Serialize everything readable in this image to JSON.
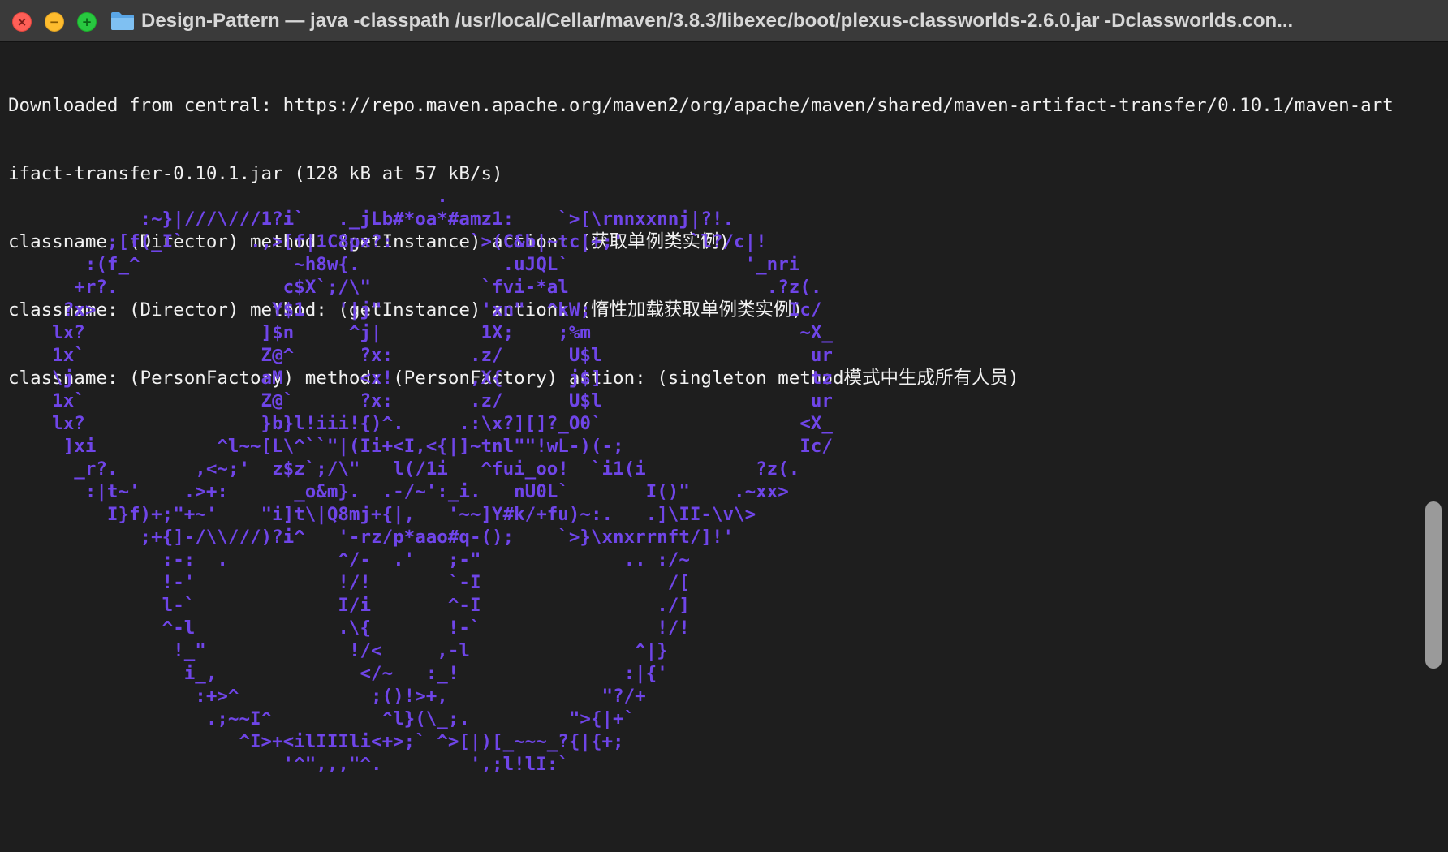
{
  "window": {
    "title": "Design-Pattern — java -classpath /usr/local/Cellar/maven/3.8.3/libexec/boot/plexus-classworlds-2.6.0.jar -Dclassworlds.con...",
    "buttons": {
      "close": "×",
      "minimize": "−",
      "maximize": "+"
    },
    "colors": {
      "close": "#fe5f57",
      "minimize": "#febc2e",
      "maximize": "#28c840",
      "background": "#1e1e1e",
      "art": "#6f45e8"
    }
  },
  "terminal": {
    "lines": [
      "Downloaded from central: https://repo.maven.apache.org/maven2/org/apache/maven/shared/maven-artifact-transfer/0.10.1/maven-art",
      "ifact-transfer-0.10.1.jar (128 kB at 57 kB/s)",
      "classname: (Director) method: (getInstance) action: (获取单例类实例)",
      "classname: (Director) method: (getInstance) action: (惰性加载获取单例类实例)",
      "classname: (PersonFactory) method: (PersonFactory) action: (singleton method模式中生成所有人员)"
    ],
    "ascii_art": [
      "                                       .",
      "            :~}|///\\///1?i`   ._jLb#*oa*#amz1:    `>[\\rnnxxnnj|?!.",
      "         ;[f(_I`      .,>[f|1C8px?:       `>(C&b|~tc|+;'      `l?/c|!",
      "       :(f_^              ~h8w{.             .uJQL`                '_nri",
      "      +r?.               c$X`;/\\\"          `fvi-*al                  .?z(.",
      "     ?x>                Y$1   '|j\"         'xn\"  ^kW;                  Ic/",
      "    lx?                ]$n     ^j|         1X;    ;%m                   ~X_",
      "    1x`                Z@^      ?x:       .z/      U$l                   ur",
      "    \\j                 aM       <x!       ,X{      j$]                   tz",
      "    1x`                Z@`      ?x:       .z/      U$l                   ur",
      "    lx?                }b}l!iii!{)^.     .:\\x?][]?_O0`                  <X_",
      "     ]xi           ^l~~[L\\^``\"|(Ii+<I,<{|]~tnl\"\"!wL-)(-;                Ic/",
      "      _r?.       ,<~;'  z$z`;/\\\"   l(/1i   ^fui_oo!  `i1(i          ?z(.",
      "       :|t~'    .>+:      _o&m}.  .-/~':_i.   nU0L`       I()\"    .~xx>",
      "         I}f)+;\"+~'    \"i]t\\|Q8mj+{|,   '~~]Y#k/+fu)~:.   .]\\II-\\v\\>",
      "            ;+{]-/\\\\///)?i^   '-rz/p*aao#q-();    `>}\\xnxrrnft/]!'",
      "              :-:  .          ^/-  .'   ;-\"             .. :/~",
      "              !-'             !/!       `-I                 /[",
      "              l-`             I/i       ^-I                ./]",
      "              ^-l             .\\{       !-`                !/!",
      "               !_\"             !/<     ,-l               ^|}",
      "                i_,             </~   :_!               :|{'",
      "                 :+>^            ;()!>+,              \"?/+",
      "                  .;~~I^          ^l}(\\_;.         \">{|+`",
      "                     ^I>+<ilIIIli<+>;` ^>[|)[_~~~_?{|{+;",
      "                         '^\",,,\"^.        ',;l!lI:`"
    ]
  }
}
